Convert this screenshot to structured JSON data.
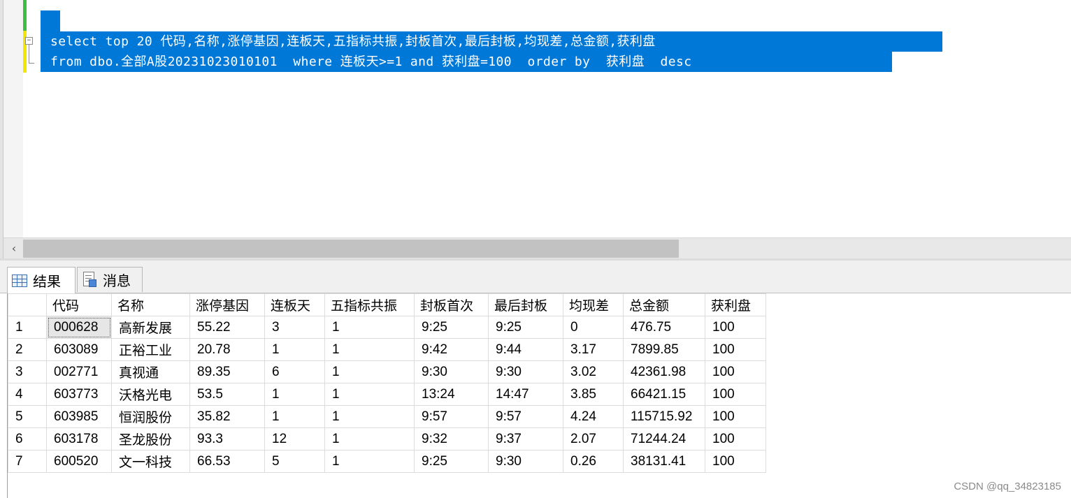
{
  "editor": {
    "line1": "select top 20 代码,名称,涨停基因,连板天,五指标共振,封板首次,最后封板,均现差,总金额,获利盘",
    "line2": "from dbo.全部A股20231023010101  where 连板天>=1 and 获利盘=100  order by  获利盘  desc",
    "outline_toggle": "−",
    "scroll_left_arrow": "‹"
  },
  "tabs": [
    {
      "label": "结果",
      "icon": "grid-icon"
    },
    {
      "label": "消息",
      "icon": "messages-icon"
    }
  ],
  "results": {
    "columns": [
      "",
      "代码",
      "名称",
      "涨停基因",
      "连板天",
      "五指标共振",
      "封板首次",
      "最后封板",
      "均现差",
      "总金额",
      "获利盘"
    ],
    "rows": [
      [
        "1",
        "000628",
        "高新发展",
        "55.22",
        "3",
        "1",
        "9:25",
        "9:25",
        "0",
        "476.75",
        "100"
      ],
      [
        "2",
        "603089",
        "正裕工业",
        "20.78",
        "1",
        "1",
        "9:42",
        "9:44",
        "3.17",
        "7899.85",
        "100"
      ],
      [
        "3",
        "002771",
        "真视通",
        "89.35",
        "6",
        "1",
        "9:30",
        "9:30",
        "3.02",
        "42361.98",
        "100"
      ],
      [
        "4",
        "603773",
        "沃格光电",
        "53.5",
        "1",
        "1",
        "13:24",
        "14:47",
        "3.85",
        "66421.15",
        "100"
      ],
      [
        "5",
        "603985",
        "恒润股份",
        "35.82",
        "1",
        "1",
        "9:57",
        "9:57",
        "4.24",
        "115715.92",
        "100"
      ],
      [
        "6",
        "603178",
        "圣龙股份",
        "93.3",
        "12",
        "1",
        "9:32",
        "9:37",
        "2.07",
        "71244.24",
        "100"
      ],
      [
        "7",
        "600520",
        "文一科技",
        "66.53",
        "5",
        "1",
        "9:25",
        "9:30",
        "0.26",
        "38131.41",
        "100"
      ]
    ]
  },
  "watermark": "CSDN @qq_34823185",
  "colors": {
    "selection": "#0078d7",
    "change_saved": "#3cbf3c",
    "change_unsaved": "#f2e600"
  }
}
